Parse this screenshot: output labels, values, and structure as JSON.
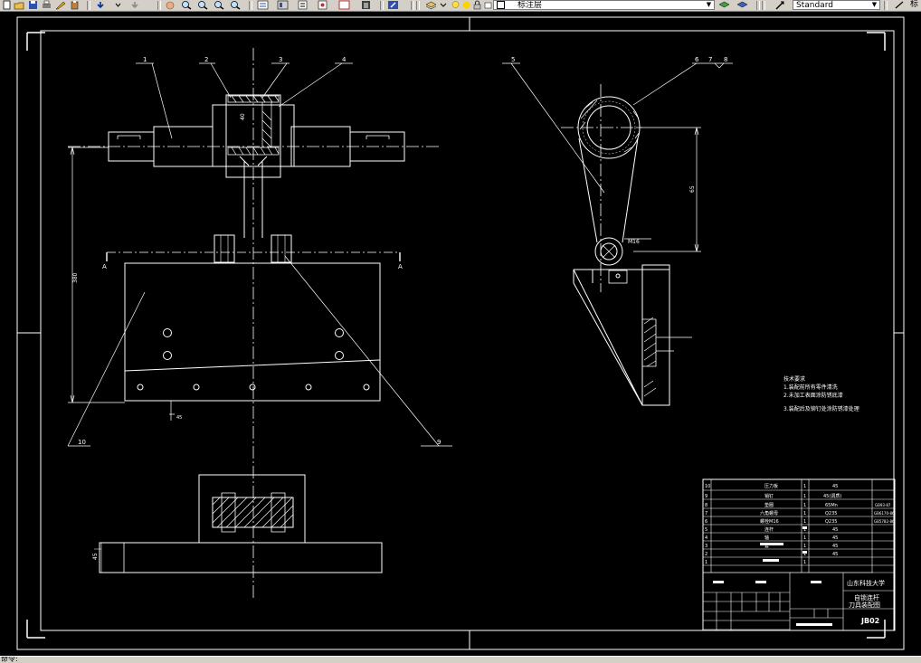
{
  "toolbar": {
    "layer_name": "标注层",
    "style_name": "Standard",
    "right_label": "标"
  },
  "status": {
    "prompt": "命令:"
  },
  "drawing": {
    "balloons": [
      "1",
      "2",
      "3",
      "4",
      "5",
      "6",
      "7",
      "8",
      "9",
      "10"
    ],
    "section_mark": "A",
    "dim_vertical": "380",
    "dim_right": "45",
    "dim_side": "65",
    "dim_base": "45",
    "dim_small": "40",
    "dim_hole": "M16",
    "tech_title": "技术要求",
    "tech_notes": [
      "1.装配前所有零件清洗",
      "2.未加工表面涂防锈底漆",
      "3.装配后及铆钉处涂防锈漆处理"
    ]
  },
  "bom": [
    {
      "no": "10",
      "name": "压力板",
      "qty": "1",
      "material": "45"
    },
    {
      "no": "9",
      "name": "销钉",
      "qty": "1",
      "material": "45(调质)"
    },
    {
      "no": "8",
      "name": "垫圈",
      "qty": "1",
      "material": "65Mn"
    },
    {
      "no": "7",
      "name": "六角螺母",
      "qty": "1",
      "material": "Q235"
    },
    {
      "no": "6",
      "name": "螺栓M16",
      "qty": "1",
      "material": "Q235"
    },
    {
      "no": "5",
      "name": "连杆",
      "qty": "1",
      "material": "45"
    },
    {
      "no": "4",
      "name": "轴",
      "qty": "1",
      "material": "45"
    },
    {
      "no": "3",
      "name": "套",
      "qty": "1",
      "material": "45"
    },
    {
      "no": "2",
      "name": "",
      "qty": "1",
      "material": "45"
    },
    {
      "no": "1",
      "name": "",
      "qty": "1",
      "material": ""
    }
  ],
  "titleblock": {
    "school": "山东科技大学",
    "drawing_name_1": "自锁连杆",
    "drawing_name_2": "刀具装配图",
    "drawing_no": "JB02",
    "std_codes": [
      "GB93-87",
      "GB6170-86",
      "GB5782-86"
    ]
  }
}
